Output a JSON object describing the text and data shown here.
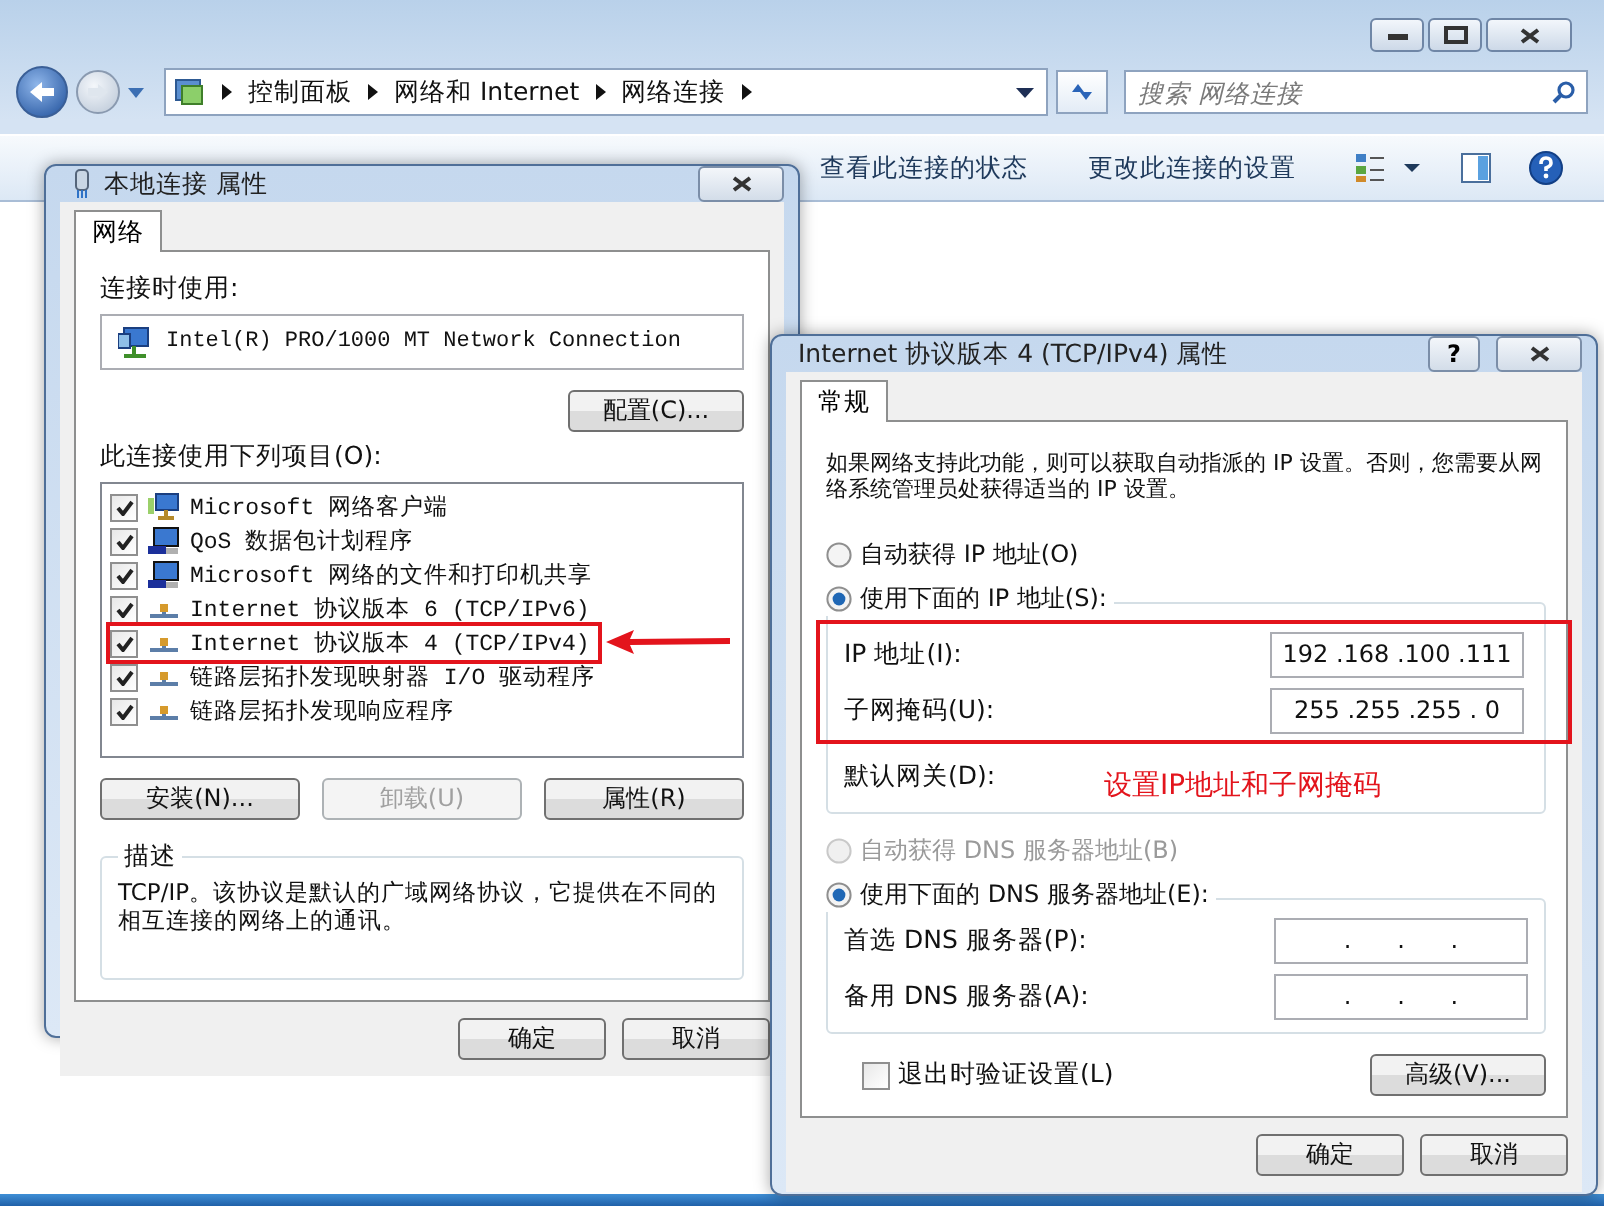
{
  "explorer": {
    "breadcrumb": [
      "控制面板",
      "网络和 Internet",
      "网络连接"
    ],
    "search": {
      "placeholder": "搜索 网络连接"
    },
    "toolbar": [
      "查看此连接的状态",
      "更改此连接的设置"
    ]
  },
  "connection_dialog": {
    "title": "本地连接 属性",
    "tabs": [
      {
        "label": "网络",
        "selected": true
      }
    ],
    "connect_using_label": "连接时使用:",
    "adapter": "Intel(R) PRO/1000 MT Network Connection",
    "configure_button": "配置(C)...",
    "items_label": "此连接使用下列项目(O):",
    "items": [
      {
        "label": "Microsoft 网络客户端",
        "checked": true,
        "kind": "client",
        "marked": false
      },
      {
        "label": "QoS 数据包计划程序",
        "checked": true,
        "kind": "service",
        "marked": false
      },
      {
        "label": "Microsoft 网络的文件和打印机共享",
        "checked": true,
        "kind": "service",
        "marked": false
      },
      {
        "label": "Internet 协议版本 6 (TCP/IPv6)",
        "checked": true,
        "kind": "protocol",
        "marked": false
      },
      {
        "label": "Internet 协议版本 4 (TCP/IPv4)",
        "checked": true,
        "kind": "protocol",
        "marked": true
      },
      {
        "label": "链路层拓扑发现映射器 I/O 驱动程序",
        "checked": true,
        "kind": "protocol",
        "marked": false
      },
      {
        "label": "链路层拓扑发现响应程序",
        "checked": true,
        "kind": "protocol",
        "marked": false
      }
    ],
    "item_buttons": [
      {
        "label": "安装(N)...",
        "disabled": false
      },
      {
        "label": "卸载(U)",
        "disabled": true
      },
      {
        "label": "属性(R)",
        "disabled": false
      }
    ],
    "description_title": "描述",
    "description": "TCP/IP。该协议是默认的广域网络协议，它提供在不同的相互连接的网络上的通讯。",
    "dialog_buttons": [
      "确定",
      "取消"
    ]
  },
  "ipv4_dialog": {
    "title": "Internet 协议版本 4 (TCP/IPv4) 属性",
    "help_button": "?",
    "tabs": [
      {
        "label": "常规",
        "selected": true
      }
    ],
    "intro": "如果网络支持此功能，则可以获取自动指派的 IP 设置。否则，您需要从网络系统管理员处获得适当的 IP 设置。",
    "ip_options": [
      {
        "label": "自动获得 IP 地址(O)",
        "selected": false,
        "disabled": false
      },
      {
        "label": "使用下面的 IP 地址(S):",
        "selected": true,
        "disabled": false
      }
    ],
    "ip_fields": [
      {
        "label": "IP 地址(I):",
        "value": "192 .168 .100 .111",
        "marked": true
      },
      {
        "label": "子网掩码(U):",
        "value": "255 .255 .255 . 0",
        "marked": true
      },
      {
        "label": "默认网关(D):",
        "marked": false
      }
    ],
    "annotation": "设置IP地址和子网掩码",
    "dns_options": [
      {
        "label": "自动获得 DNS 服务器地址(B)",
        "selected": false,
        "disabled": true
      },
      {
        "label": "使用下面的 DNS 服务器地址(E):",
        "selected": true,
        "disabled": false
      }
    ],
    "dns_fields": [
      {
        "label": "首选 DNS 服务器(P):",
        "value": ".      .      ."
      },
      {
        "label": "备用 DNS 服务器(A):",
        "value": ".      .      ."
      }
    ],
    "validate_checkbox": {
      "label": "退出时验证设置(L)",
      "checked": false
    },
    "advanced_button": "高级(V)...",
    "dialog_buttons": [
      "确定",
      "取消"
    ]
  }
}
